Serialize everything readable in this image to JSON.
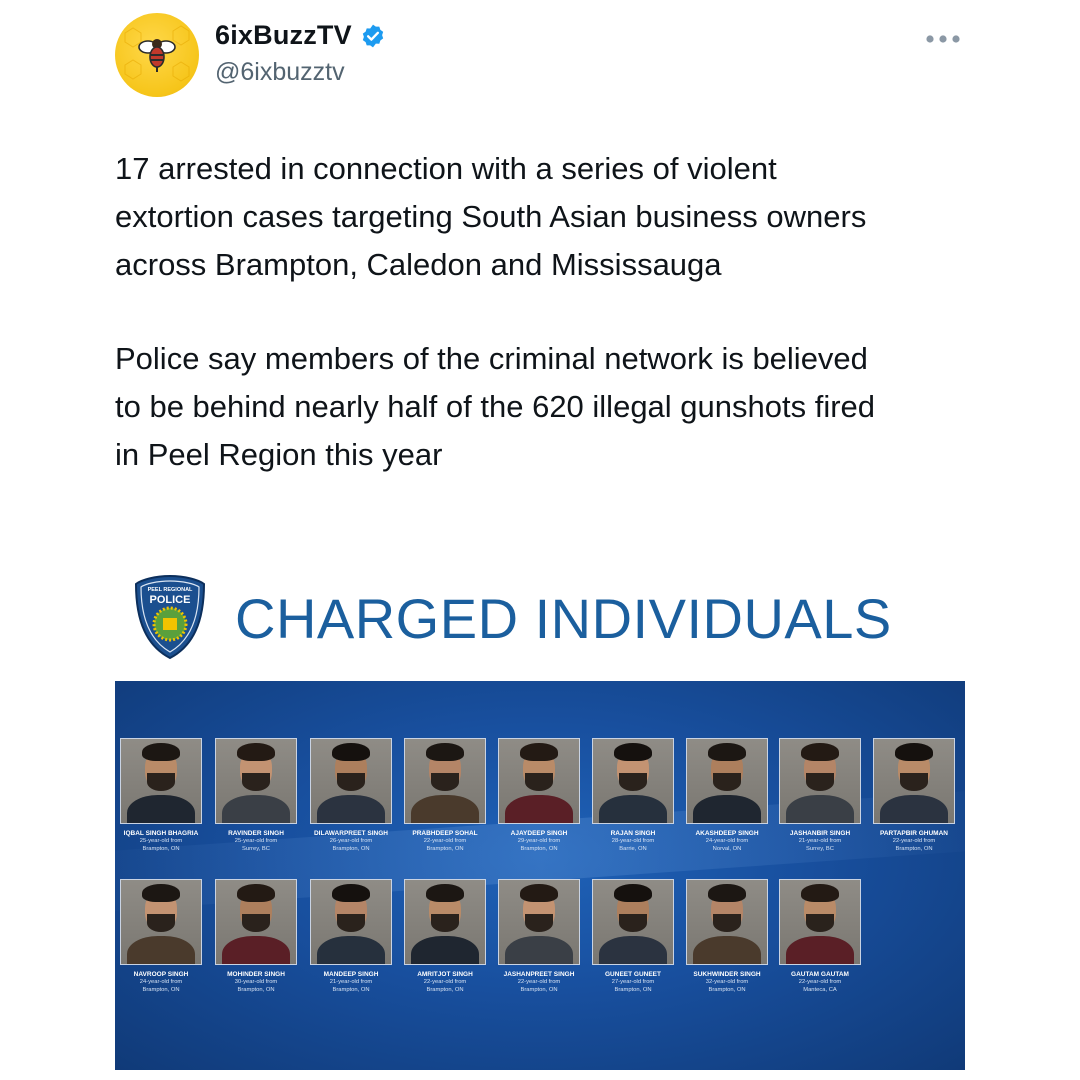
{
  "account": {
    "display_name": "6ixBuzzTV",
    "handle": "@6ixbuzztv",
    "verified": true,
    "avatar_icon": "bee-logo-icon",
    "avatar_color": "#f6c51a"
  },
  "tweet": {
    "paragraph_1": "17 arrested in connection with a series of violent\nextortion cases targeting South Asian business owners\nacross Brampton, Caledon and Mississauga",
    "paragraph_2": "Police say members of the criminal network is believed\nto be behind nearly half of the 620 illegal gunshots fired\nin Peel Region this year"
  },
  "media": {
    "badge_top": "PEEL REGIONAL",
    "badge_main": "POLICE",
    "headline": "CHARGED INDIVIDUALS",
    "accent_color": "#1b5f9e",
    "board_color": "#184f9e",
    "individuals": [
      {
        "name": "IQBAL SINGH BHAGRIA",
        "age": "25-year-old from",
        "place": "Brampton, ON"
      },
      {
        "name": "RAVINDER SINGH",
        "age": "25-year-old from",
        "place": "Surrey, BC"
      },
      {
        "name": "DILAWARPREET SINGH",
        "age": "26-year-old from",
        "place": "Brampton, ON"
      },
      {
        "name": "PRABHDEEP SOHAL",
        "age": "22-year-old from",
        "place": "Brampton, ON"
      },
      {
        "name": "AJAYDEEP SINGH",
        "age": "29-year-old from",
        "place": "Brampton, ON"
      },
      {
        "name": "RAJAN SINGH",
        "age": "28-year-old from",
        "place": "Barrie, ON"
      },
      {
        "name": "AKASHDEEP SINGH",
        "age": "24-year-old from",
        "place": "Norval, ON"
      },
      {
        "name": "JASHANBIR SINGH",
        "age": "21-year-old from",
        "place": "Surrey, BC"
      },
      {
        "name": "PARTAPBIR GHUMAN",
        "age": "22-year-old from",
        "place": "Brampton, ON"
      },
      {
        "name": "NAVROOP SINGH",
        "age": "24-year-old from",
        "place": "Brampton, ON"
      },
      {
        "name": "MOHINDER SINGH",
        "age": "30-year-old from",
        "place": "Brampton, ON"
      },
      {
        "name": "MANDEEP SINGH",
        "age": "21-year-old from",
        "place": "Brampton, ON"
      },
      {
        "name": "AMRITJOT SINGH",
        "age": "22-year-old from",
        "place": "Brampton, ON"
      },
      {
        "name": "JASHANPREET SINGH",
        "age": "22-year-old from",
        "place": "Brampton, ON"
      },
      {
        "name": "GUNEET GUNEET",
        "age": "27-year-old from",
        "place": "Brampton, ON"
      },
      {
        "name": "SUKHWINDER SINGH",
        "age": "32-year-old from",
        "place": "Brampton, ON"
      },
      {
        "name": "GAUTAM GAUTAM",
        "age": "22-year-old from",
        "place": "Manteca, CA"
      }
    ]
  }
}
